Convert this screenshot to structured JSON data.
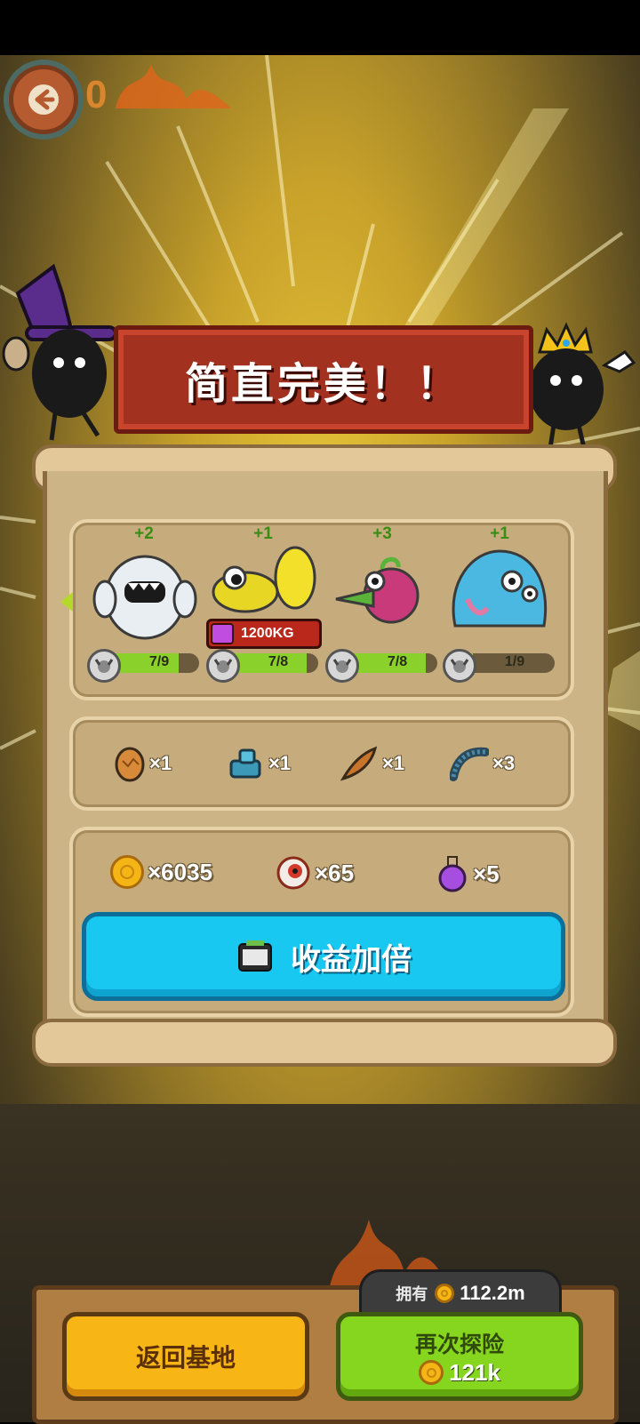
{
  "hud": {
    "score": "0"
  },
  "banner": {
    "title": "简直完美！！"
  },
  "monsters": [
    {
      "bonus": "+2",
      "level": "7/9",
      "progress": 0.778
    },
    {
      "bonus": "+1",
      "level": "7/8",
      "progress": 0.875,
      "weight": "1200KG"
    },
    {
      "bonus": "+3",
      "level": "7/8",
      "progress": 0.875
    },
    {
      "bonus": "+1",
      "level": "1/9",
      "progress": 0.111
    }
  ],
  "items": [
    {
      "icon": "egg-icon",
      "count": "×1"
    },
    {
      "icon": "turret-icon",
      "count": "×1"
    },
    {
      "icon": "feather-icon",
      "count": "×1"
    },
    {
      "icon": "worm-icon",
      "count": "×3"
    }
  ],
  "rewards": [
    {
      "icon": "coin-icon",
      "count": "×6035"
    },
    {
      "icon": "eyeball-icon",
      "count": "×65"
    },
    {
      "icon": "potion-icon",
      "count": "×5"
    }
  ],
  "double_button": {
    "label": "收益加倍"
  },
  "bottom": {
    "owned_label": "拥有",
    "owned_value": "112.2m",
    "return_label": "返回基地",
    "again_label": "再次探险",
    "again_cost": "121k"
  },
  "colors": {
    "banner": "#a3311f",
    "double_button": "#18c8f0",
    "return_button": "#f7b516",
    "again_button": "#86d51e",
    "level_fill": "#8ad12c"
  }
}
